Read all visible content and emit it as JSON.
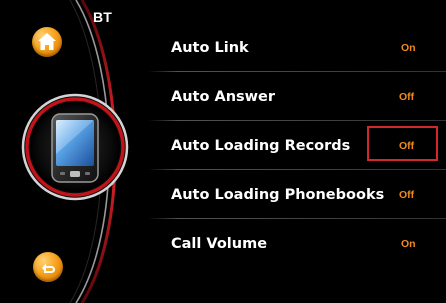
{
  "screen": {
    "title": "BT"
  },
  "nav": {
    "home_icon": "home-icon",
    "back_icon": "back-arrow-icon",
    "device_icon": "smartphone-icon"
  },
  "colors": {
    "accent": "#f08a1e",
    "highlight": "#d2282d",
    "ring_red": "#c0141a",
    "background": "#000000",
    "label": "#ffffff"
  },
  "settings": [
    {
      "label": "Auto Link",
      "value": "On"
    },
    {
      "label": "Auto Answer",
      "value": "Off"
    },
    {
      "label": "Auto Loading Records",
      "value": "Off",
      "highlighted": true
    },
    {
      "label": "Auto Loading Phonebooks",
      "value": "Off"
    },
    {
      "label": "Call Volume",
      "value": "On"
    }
  ]
}
